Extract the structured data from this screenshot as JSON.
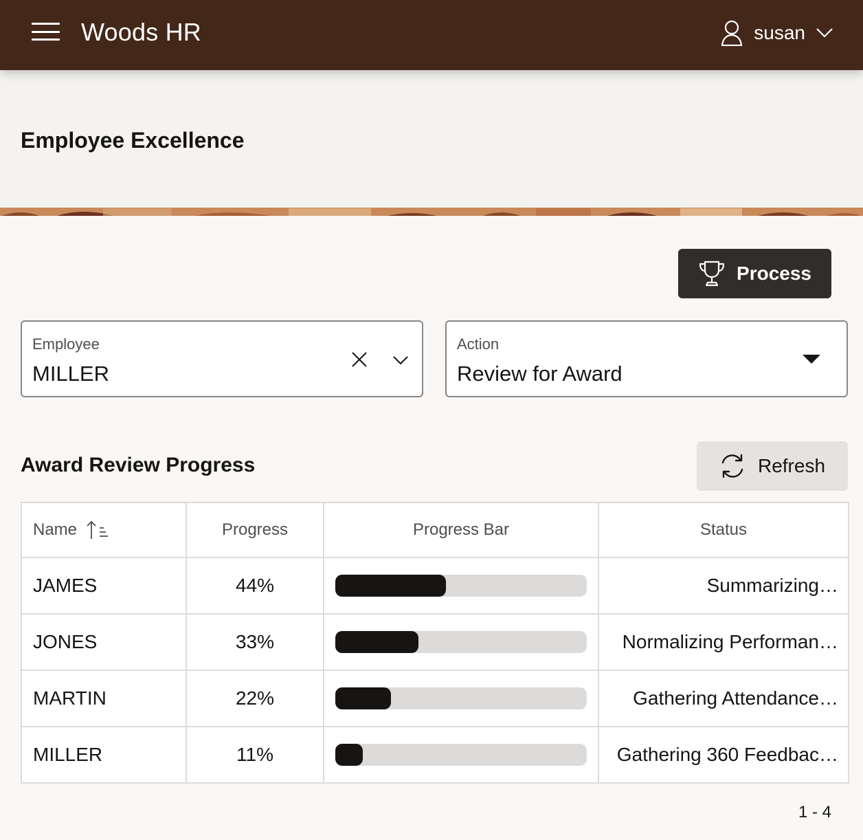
{
  "header": {
    "app_title": "Woods HR",
    "user_name": "susan"
  },
  "page": {
    "title": "Employee Excellence"
  },
  "toolbar": {
    "process_label": "Process",
    "refresh_label": "Refresh"
  },
  "form": {
    "employee": {
      "label": "Employee",
      "value": "MILLER"
    },
    "action": {
      "label": "Action",
      "value": "Review for Award"
    }
  },
  "section": {
    "title": "Award Review Progress"
  },
  "table": {
    "columns": [
      "Name",
      "Progress",
      "Progress Bar",
      "Status"
    ],
    "rows": [
      {
        "name": "JAMES",
        "progress": "44%",
        "fraction": 0.44,
        "status": "Summarizing…"
      },
      {
        "name": "JONES",
        "progress": "33%",
        "fraction": 0.33,
        "status": "Normalizing Performan…"
      },
      {
        "name": "MARTIN",
        "progress": "22%",
        "fraction": 0.22,
        "status": "Gathering Attendance…"
      },
      {
        "name": "MILLER",
        "progress": "11%",
        "fraction": 0.11,
        "status": "Gathering 360 Feedbac…"
      }
    ]
  },
  "pagination": {
    "range": "1 - 4"
  },
  "colors": {
    "header_bg": "#432718",
    "primary_button": "#312d2a",
    "bar_fill": "#161513",
    "bar_track": "#dcdbd9"
  },
  "icons": {
    "menu": "hamburger-icon",
    "user": "user-icon",
    "dropdown": "chevron-down-icon",
    "process": "trophy-icon",
    "clear": "close-icon",
    "action_select": "caret-down-icon",
    "refresh": "refresh-icon",
    "sort": "sort-ascending-icon"
  }
}
